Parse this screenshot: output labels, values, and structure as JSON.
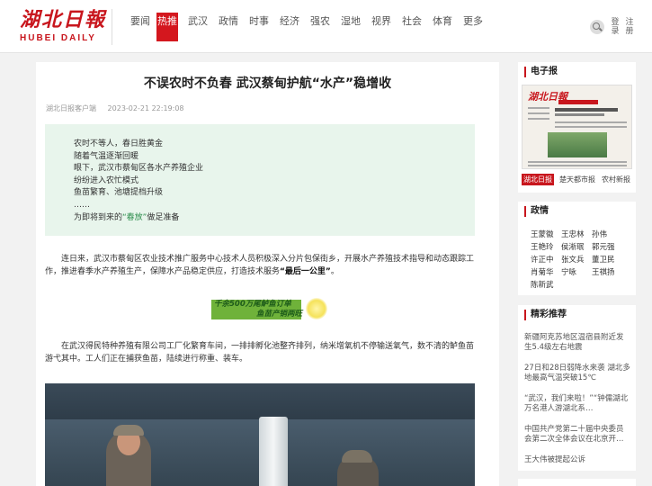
{
  "logo": {
    "cn": "湖北日報",
    "en": "HUBEI DAILY"
  },
  "nav": {
    "items": [
      {
        "label": "要闻",
        "active": false
      },
      {
        "label": "热推",
        "active": true
      },
      {
        "label": "武汉",
        "active": false
      },
      {
        "label": "政情",
        "active": false
      },
      {
        "label": "时事",
        "active": false
      },
      {
        "label": "经济",
        "active": false
      },
      {
        "label": "强农",
        "active": false
      },
      {
        "label": "湿地",
        "active": false
      },
      {
        "label": "视界",
        "active": false
      },
      {
        "label": "社会",
        "active": false
      },
      {
        "label": "体育",
        "active": false
      },
      {
        "label": "更多",
        "active": false
      }
    ],
    "login": "登录",
    "register": "注册"
  },
  "article": {
    "title": "不误农时不负春 武汉蔡甸护航“水产”稳增收",
    "source": "湖北日报客户端",
    "datetime": "2023-02-21 22:19:08",
    "lead": [
      "农时不等人，春日胜黄金",
      "随着气温逐渐回暖",
      "眼下，武汉市蔡甸区各水产养殖企业",
      "纷纷进入农忙模式",
      "鱼苗繁育、池塘提档升级",
      "……"
    ],
    "lead_last_prefix": "为即将到来的",
    "lead_last_highlight": "“春放”",
    "lead_last_suffix": "做足准备",
    "para1": "连日来，武汉市蔡甸区农业技术推广服务中心技术人员积极深入分片包保街乡，开展水产养殖技术指导和动态跟踪工作，推进春季水产养殖生产，保障水产品稳定供应，打造技术服务",
    "para1_bold": "“最后一公里”",
    "para1_end": "。",
    "subhead_line1": "千余500万尾鲈鱼订单",
    "subhead_line2": "鱼苗产销两旺",
    "para2": "在武汉得民特种养殖有限公司工厂化繁育车间，一排排孵化池整齐排列，纳米增氧机不停输送氧气，数不清的鲈鱼苗游弋其中。工人们正在捕获鱼苗，陆续进行称重、装车。"
  },
  "sidebar": {
    "epaper": {
      "title": "电子报",
      "masthead": "湖北日報",
      "tabs": [
        "湖北日报",
        "楚天都市报",
        "农村新报"
      ]
    },
    "officials": {
      "title": "政情",
      "names": [
        "王蒙徽",
        "王忠林",
        "孙伟",
        "王艳玲",
        "侯淅珉",
        "郭元强",
        "许正中",
        "张文兵",
        "董卫民",
        "肖菊华",
        "宁咏",
        "王祺扬",
        "陈新武"
      ]
    },
    "recommend": {
      "title": "精彩推荐",
      "items": [
        "新疆阿克苏地区温宿县附近发生5.4级左右地震",
        "27日和28日弱降水来袭 湖北多地最高气温突破15℃",
        "“武汉，我们来啦！”“钟儒湖北万名港人游湖北系…",
        "中国共产党第二十届中央委员会第二次全体会议在北京开…",
        "王大伟被提起公诉"
      ]
    }
  }
}
